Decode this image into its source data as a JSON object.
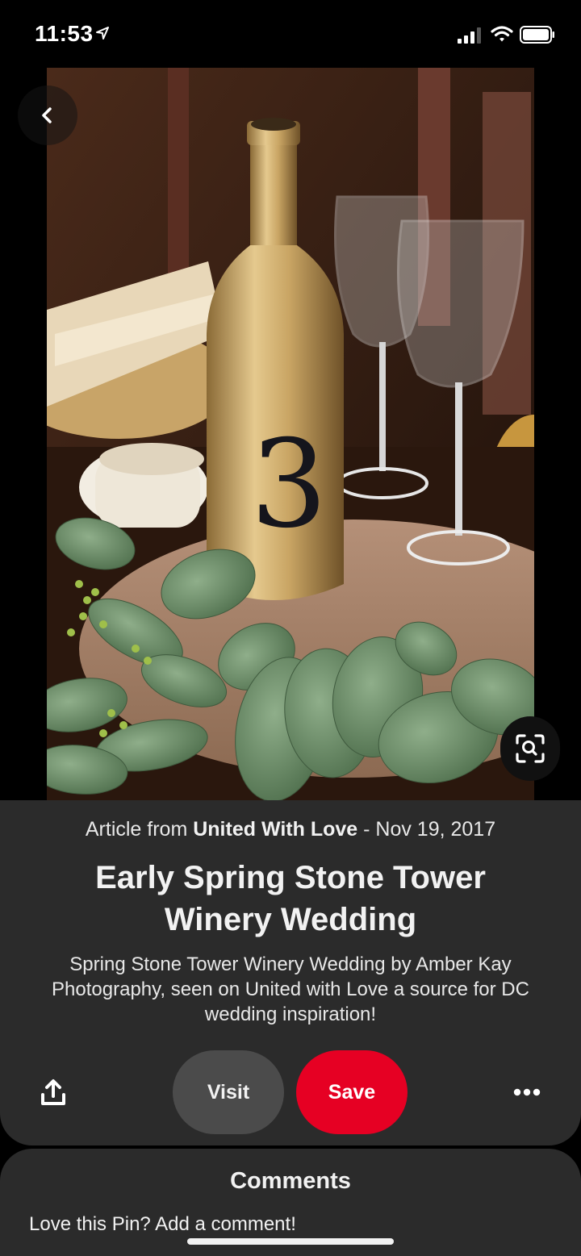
{
  "status_bar": {
    "time": "11:53",
    "icons": [
      "location-arrow-icon",
      "signal-icon",
      "wifi-icon",
      "battery-icon"
    ]
  },
  "pin": {
    "image_icons": [
      "back-chevron-icon",
      "visual-search-icon"
    ],
    "article_prefix": "Article from ",
    "source": "United With Love",
    "date_suffix": " - Nov 19, 2017",
    "title": "Early Spring Stone Tower Winery Wedding",
    "description": "Spring Stone Tower Winery Wedding by Amber Kay Photography, seen on United with Love a source for DC wedding inspiration!"
  },
  "actions": {
    "visit_label": "Visit",
    "save_label": "Save",
    "icons": [
      "share-icon",
      "more-icon"
    ]
  },
  "comments": {
    "title": "Comments",
    "prompt": "Love this Pin? Add a comment!"
  },
  "colors": {
    "save_red": "#e60023",
    "card_bg": "#2b2b2b",
    "visit_bg": "#4b4b4b"
  }
}
